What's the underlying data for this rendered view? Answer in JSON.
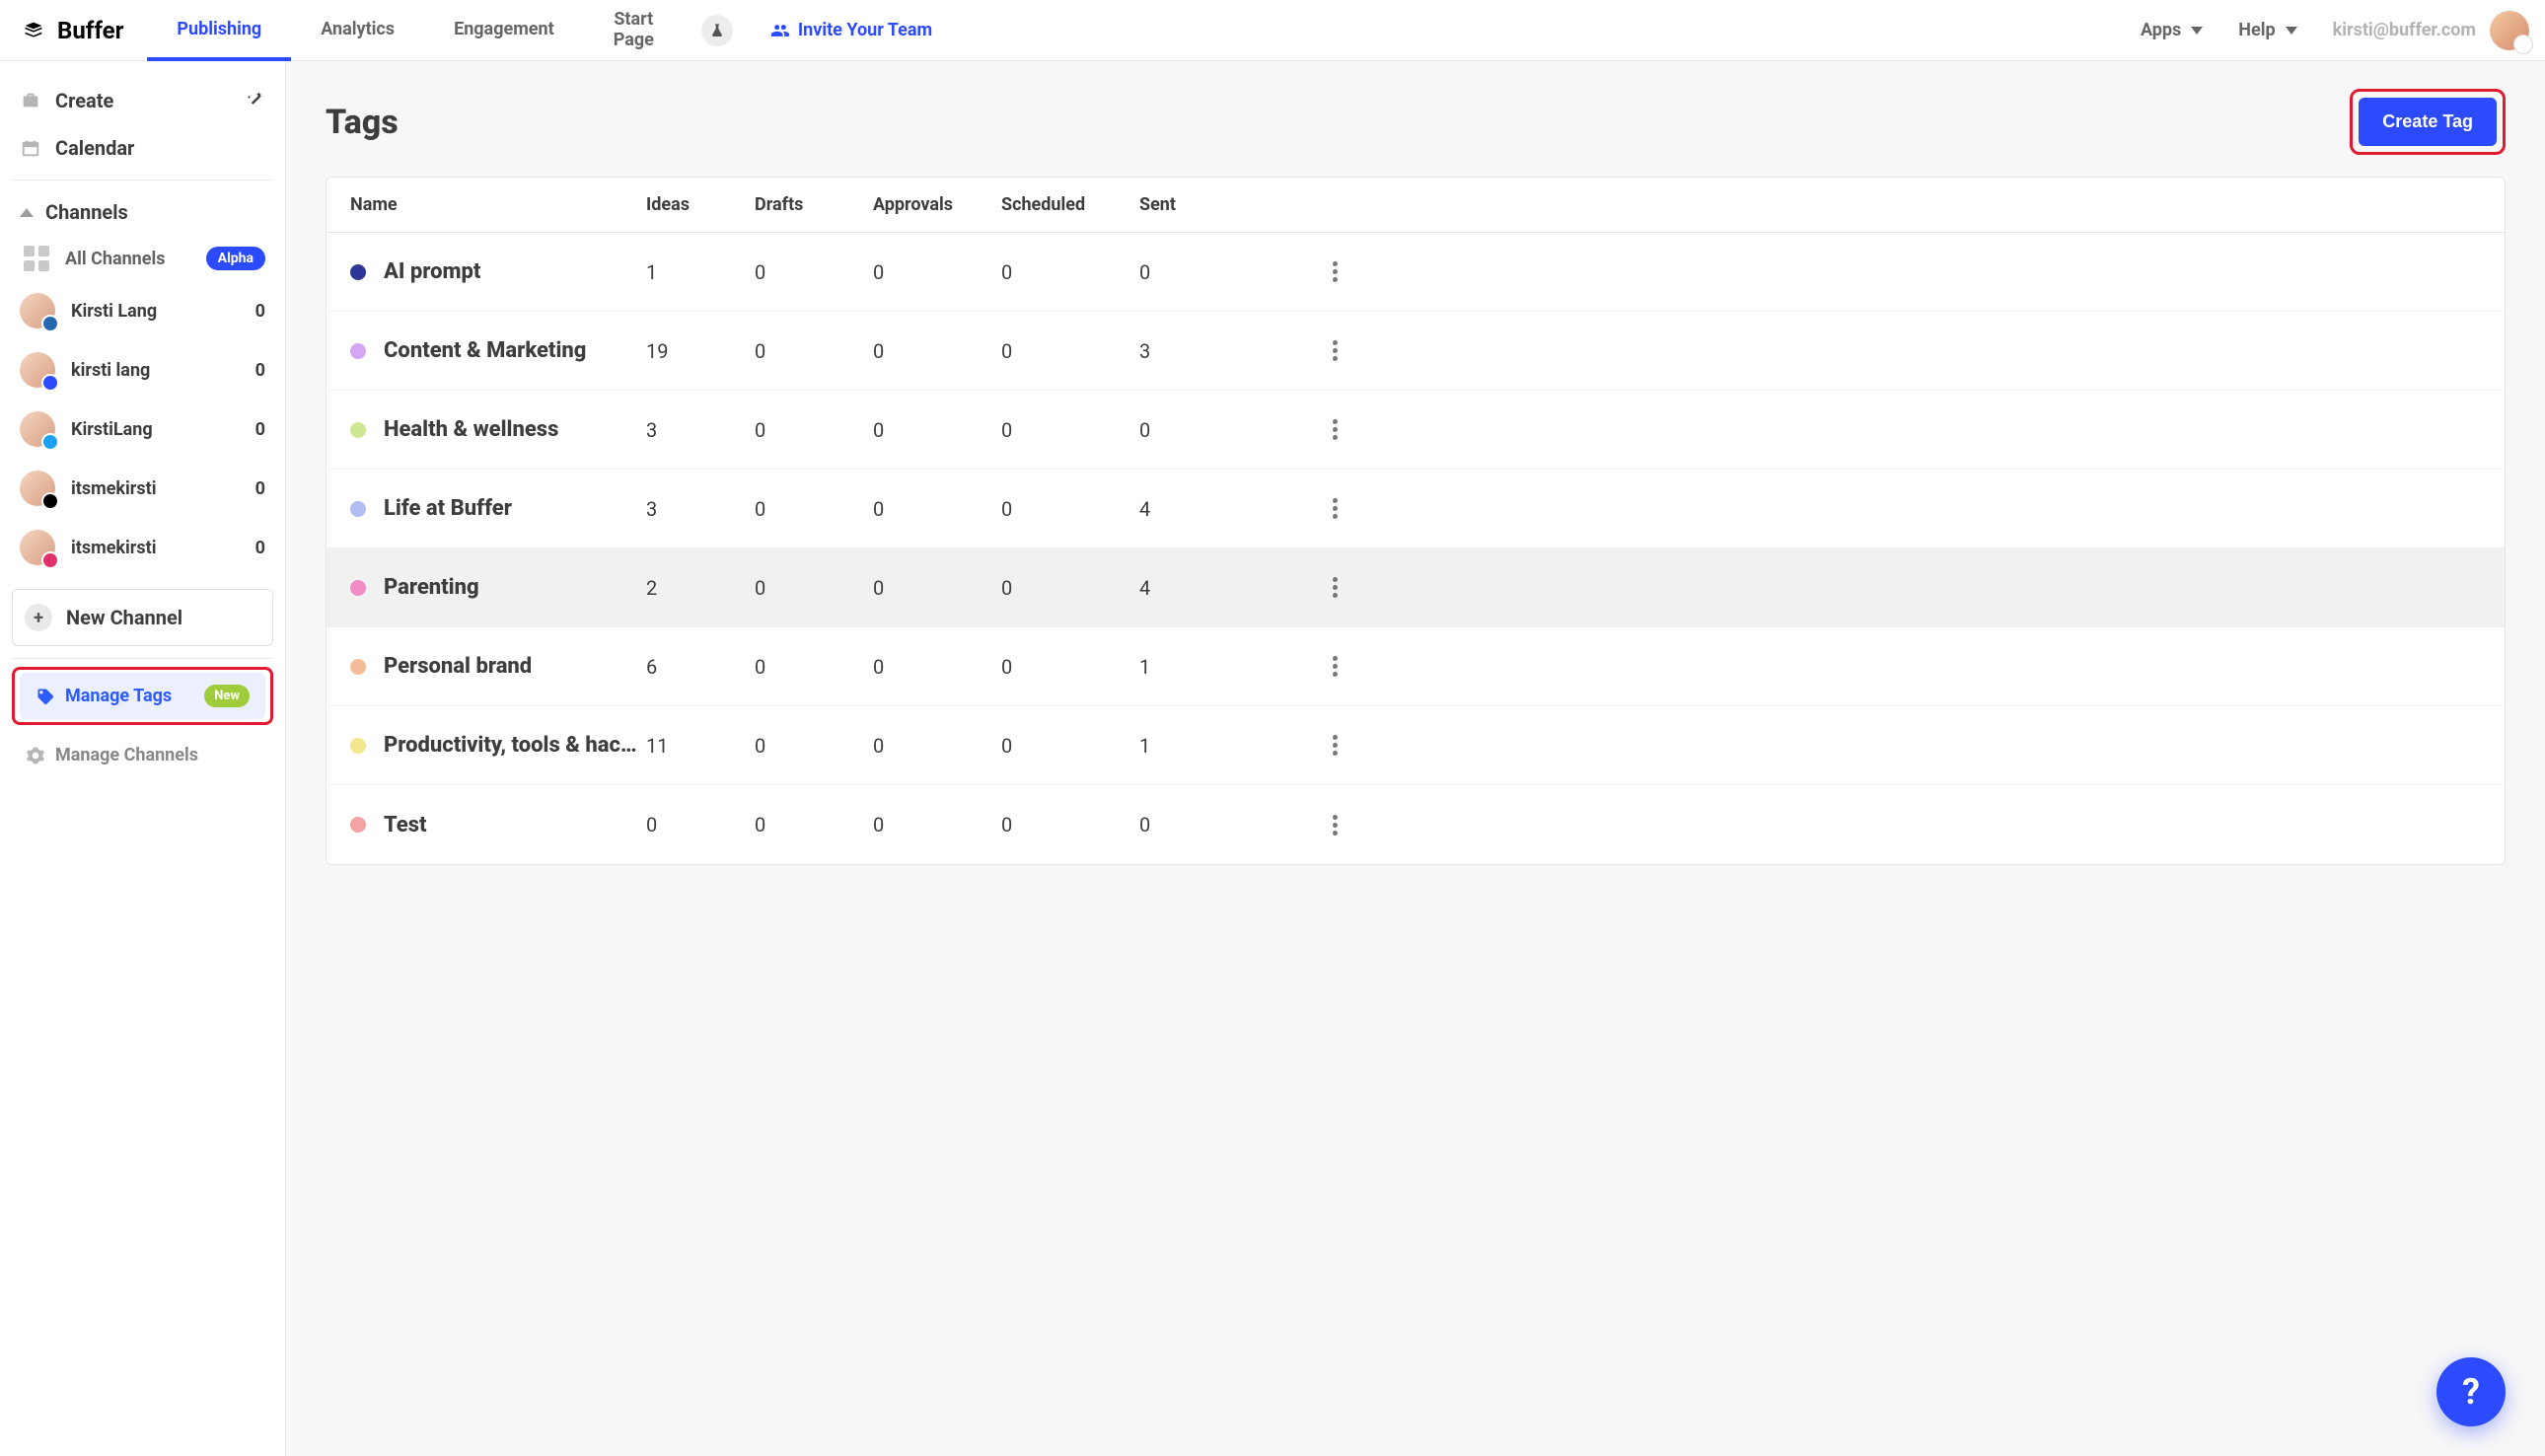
{
  "brand": "Buffer",
  "topnav": {
    "tabs": [
      {
        "label": "Publishing",
        "active": true
      },
      {
        "label": "Analytics",
        "active": false
      },
      {
        "label": "Engagement",
        "active": false
      },
      {
        "label": "Start\nPage",
        "active": false
      }
    ],
    "invite_label": "Invite Your Team",
    "apps_label": "Apps",
    "help_label": "Help",
    "user_email": "kirsti@buffer.com"
  },
  "sidebar": {
    "create_label": "Create",
    "calendar_label": "Calendar",
    "channels_label": "Channels",
    "all_channels_label": "All Channels",
    "all_channels_badge": "Alpha",
    "channels": [
      {
        "name": "Kirsti Lang",
        "count": "0",
        "badgeClass": "b-li"
      },
      {
        "name": "kirsti lang",
        "count": "0",
        "badgeClass": "b-gb"
      },
      {
        "name": "KirstiLang",
        "count": "0",
        "badgeClass": "b-tw"
      },
      {
        "name": "itsmekirsti",
        "count": "0",
        "badgeClass": "b-tt"
      },
      {
        "name": "itsmekirsti",
        "count": "0",
        "badgeClass": "b-ig"
      }
    ],
    "new_channel_label": "New Channel",
    "manage_tags_label": "Manage Tags",
    "manage_tags_badge": "New",
    "manage_channels_label": "Manage Channels"
  },
  "page": {
    "title": "Tags",
    "create_tag_label": "Create Tag",
    "columns": {
      "name": "Name",
      "ideas": "Ideas",
      "drafts": "Drafts",
      "approvals": "Approvals",
      "scheduled": "Scheduled",
      "sent": "Sent"
    },
    "rows": [
      {
        "color": "#2b3797",
        "name": "AI prompt",
        "ideas": "1",
        "drafts": "0",
        "approvals": "0",
        "scheduled": "0",
        "sent": "0"
      },
      {
        "color": "#d5a6f3",
        "name": "Content & Marketing",
        "ideas": "19",
        "drafts": "0",
        "approvals": "0",
        "scheduled": "0",
        "sent": "3"
      },
      {
        "color": "#cce890",
        "name": "Health & wellness",
        "ideas": "3",
        "drafts": "0",
        "approvals": "0",
        "scheduled": "0",
        "sent": "0"
      },
      {
        "color": "#b1bdf4",
        "name": "Life at Buffer",
        "ideas": "3",
        "drafts": "0",
        "approvals": "0",
        "scheduled": "0",
        "sent": "4"
      },
      {
        "color": "#f28bc6",
        "name": "Parenting",
        "ideas": "2",
        "drafts": "0",
        "approvals": "0",
        "scheduled": "0",
        "sent": "4",
        "hover": true
      },
      {
        "color": "#f5bb96",
        "name": "Personal brand",
        "ideas": "6",
        "drafts": "0",
        "approvals": "0",
        "scheduled": "0",
        "sent": "1"
      },
      {
        "color": "#f3e78e",
        "name": "Productivity, tools & hac…",
        "ideas": "11",
        "drafts": "0",
        "approvals": "0",
        "scheduled": "0",
        "sent": "1"
      },
      {
        "color": "#f4a3a3",
        "name": "Test",
        "ideas": "0",
        "drafts": "0",
        "approvals": "0",
        "scheduled": "0",
        "sent": "0"
      }
    ]
  },
  "help_fab": "?"
}
